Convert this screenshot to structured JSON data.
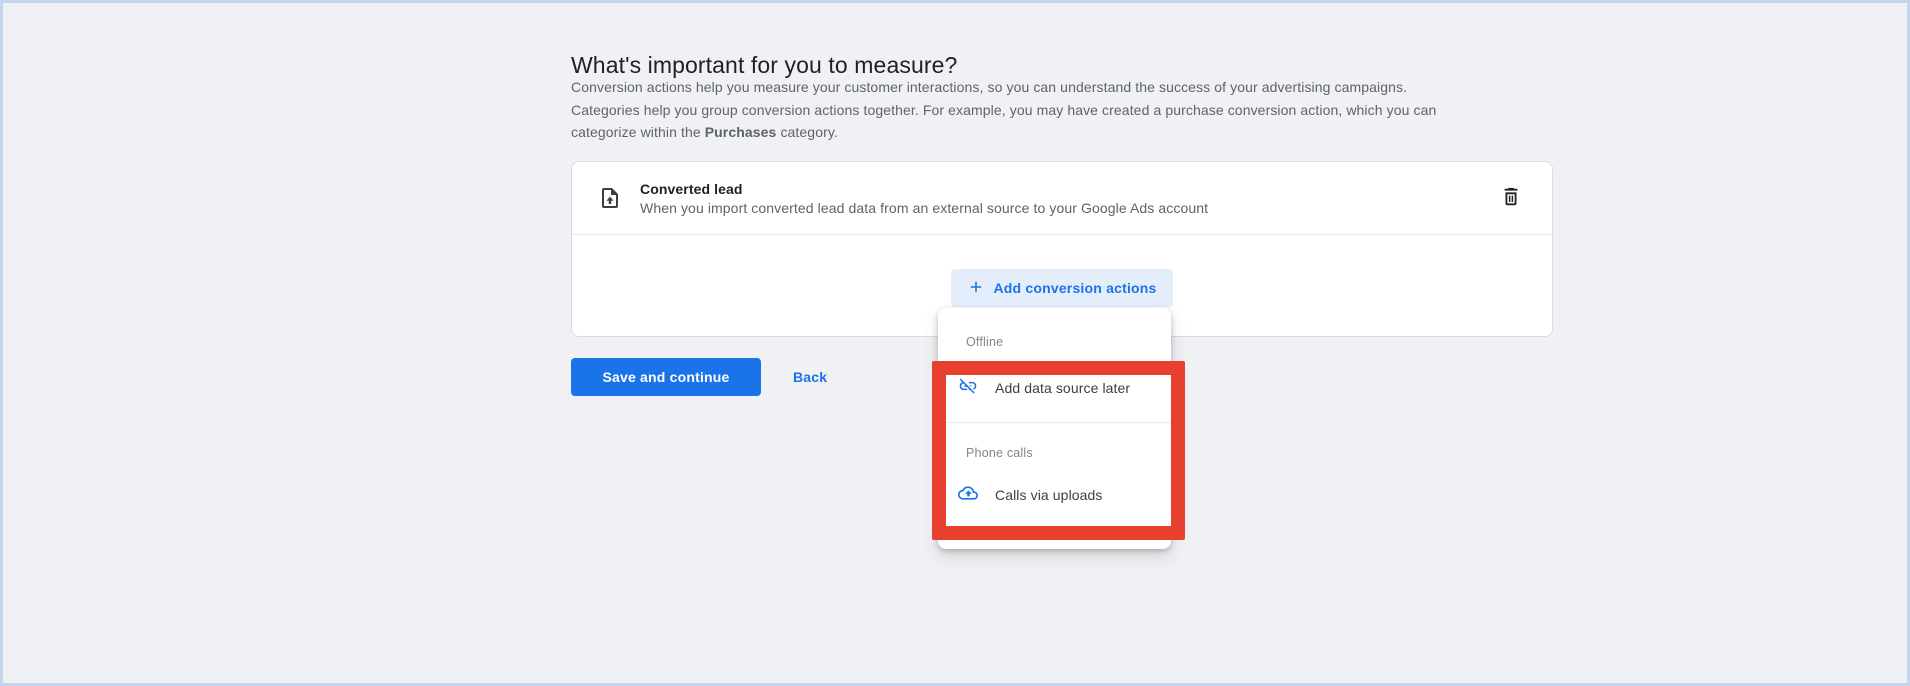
{
  "page": {
    "heading": "What's important for you to measure?",
    "description_lines": [
      "Conversion actions help you measure your customer interactions, so you can understand the success of your advertising campaigns.",
      "Categories help you group conversion actions together. For example, you may have created a purchase conversion action, which you can"
    ],
    "description_line3": {
      "prefix": "categorize within the ",
      "bold": "Purchases",
      "suffix": " category."
    }
  },
  "conversion_card": {
    "items": [
      {
        "icon": "upload-file-icon",
        "title": "Converted lead",
        "description": "When you import converted lead data from an external source to your Google Ads account",
        "delete_icon": "trash-icon"
      }
    ],
    "add_button": {
      "icon": "plus-icon",
      "label": "Add conversion actions"
    }
  },
  "dropdown": {
    "sections": [
      {
        "label": "Offline",
        "items": [
          {
            "icon": "link-off-icon",
            "label": "Add data source later"
          }
        ]
      },
      {
        "label": "Phone calls",
        "items": [
          {
            "icon": "cloud-upload-icon",
            "label": "Calls via uploads"
          }
        ]
      }
    ]
  },
  "actions": {
    "save_label": "Save and continue",
    "back_label": "Back"
  },
  "annotation": {
    "type": "highlight-rectangle",
    "color": "#e8402f"
  },
  "colors": {
    "accent_blue": "#1a73e8",
    "add_button_bg": "#e4eefb",
    "highlight_red": "#e8402f",
    "heading_text": "#202124",
    "body_text": "#5f6368",
    "surface": "#ffffff",
    "page_bg": "#f0f1f4",
    "frame_border": "#c4d6ee"
  }
}
